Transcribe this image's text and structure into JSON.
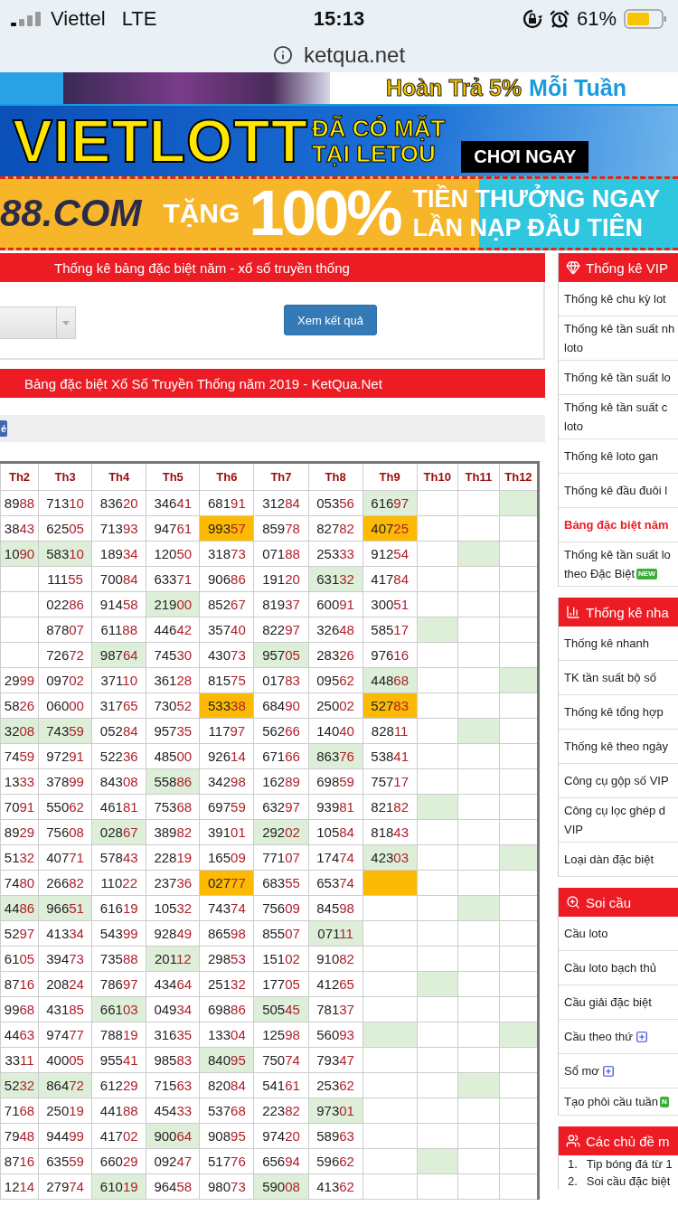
{
  "status_bar": {
    "carrier": "Viettel",
    "network": "LTE",
    "time": "15:13",
    "battery": "61%"
  },
  "address_bar": {
    "url": "ketqua.net"
  },
  "banners": [
    {
      "kind": "cashback",
      "texts": [
        "Hoàn Trả 5%",
        "Mỗi Tuần"
      ]
    },
    {
      "kind": "vietlott",
      "texts": [
        "VIETLOTT",
        "ĐÃ CÓ MẶT",
        "TẠI LETOU",
        "CHƠI NGAY"
      ]
    },
    {
      "kind": "bonus",
      "texts": [
        "88.COM",
        "TẶNG",
        "100%",
        "TIỀN THƯỞNG NGAY",
        "LẦN NẠP ĐẦU TIÊN"
      ]
    }
  ],
  "filter_panel": {
    "title": "Thống kê bảng đặc biệt năm - xổ số truyền thống",
    "button": "Xem kết quả"
  },
  "table_panel": {
    "title": "Bảng đặc biệt Xổ Số Truyền Thống năm 2019 - KetQua.Net",
    "share_button": "é"
  },
  "table": {
    "columns": [
      "Th2",
      "Th3",
      "Th4",
      "Th5",
      "Th6",
      "Th7",
      "Th8",
      "Th9",
      "Th10",
      "Th11",
      "Th12"
    ],
    "rows": [
      {
        "cells": [
          {
            "text": "8988",
            "color": "#ffffff"
          },
          {
            "text": "71310",
            "color": "#ffffff"
          },
          {
            "text": "83620",
            "color": "#ffffff"
          },
          {
            "text": "34641",
            "color": "#ffffff"
          },
          {
            "text": "68191",
            "color": "#ffffff"
          },
          {
            "text": "31284",
            "color": "#ffffff"
          },
          {
            "text": "05356",
            "color": "#ffffff"
          },
          {
            "text": "61697",
            "color": "#ddefd8"
          },
          {
            "color": "#ffffff"
          },
          {
            "color": "#ffffff"
          },
          {
            "color": "#ddefd8"
          }
        ]
      },
      {
        "cells": [
          {
            "text": "3843",
            "color": "#ffffff"
          },
          {
            "text": "62505",
            "color": "#ffffff"
          },
          {
            "text": "71393",
            "color": "#ffffff"
          },
          {
            "text": "94761",
            "color": "#ffffff"
          },
          {
            "text": "99357",
            "color": "#fdba05"
          },
          {
            "text": "85978",
            "color": "#ffffff"
          },
          {
            "text": "82782",
            "color": "#ffffff"
          },
          {
            "text": "40725",
            "color": "#fdba05"
          },
          {
            "color": "#ffffff"
          },
          {
            "color": "#ffffff"
          },
          {
            "color": "#ffffff"
          }
        ]
      },
      {
        "cells": [
          {
            "text": "1090",
            "color": "#ddefd8"
          },
          {
            "text": "58310",
            "color": "#ddefd8"
          },
          {
            "text": "18934",
            "color": "#ffffff"
          },
          {
            "text": "12050",
            "color": "#ffffff"
          },
          {
            "text": "31873",
            "color": "#ffffff"
          },
          {
            "text": "07188",
            "color": "#ffffff"
          },
          {
            "text": "25333",
            "color": "#ffffff"
          },
          {
            "text": "91254",
            "color": "#ffffff"
          },
          {
            "color": "#ffffff"
          },
          {
            "color": "#ddefd8"
          },
          {
            "color": "#ffffff"
          }
        ]
      },
      {
        "cells": [
          {
            "color": "#ffffff"
          },
          {
            "text": "11155",
            "color": "#ffffff"
          },
          {
            "text": "70084",
            "color": "#ffffff"
          },
          {
            "text": "63371",
            "color": "#ffffff"
          },
          {
            "text": "90686",
            "color": "#ffffff"
          },
          {
            "text": "19120",
            "color": "#ffffff"
          },
          {
            "text": "63132",
            "color": "#ddefd8"
          },
          {
            "text": "41784",
            "color": "#ffffff"
          },
          {
            "color": "#ffffff"
          },
          {
            "color": "#ffffff"
          },
          {
            "color": "#ffffff"
          }
        ]
      },
      {
        "cells": [
          {
            "color": "#ffffff"
          },
          {
            "text": "02286",
            "color": "#ffffff"
          },
          {
            "text": "91458",
            "color": "#ffffff"
          },
          {
            "text": "21900",
            "color": "#ddefd8"
          },
          {
            "text": "85267",
            "color": "#ffffff"
          },
          {
            "text": "81937",
            "color": "#ffffff"
          },
          {
            "text": "60091",
            "color": "#ffffff"
          },
          {
            "text": "30051",
            "color": "#ffffff"
          },
          {
            "color": "#ffffff"
          },
          {
            "color": "#ffffff"
          },
          {
            "color": "#ffffff"
          }
        ]
      },
      {
        "cells": [
          {
            "color": "#ffffff"
          },
          {
            "text": "87807",
            "color": "#ffffff"
          },
          {
            "text": "61188",
            "color": "#ffffff"
          },
          {
            "text": "44642",
            "color": "#ffffff"
          },
          {
            "text": "35740",
            "color": "#ffffff"
          },
          {
            "text": "82297",
            "color": "#ffffff"
          },
          {
            "text": "32648",
            "color": "#ffffff"
          },
          {
            "text": "58517",
            "color": "#ffffff"
          },
          {
            "color": "#ddefd8"
          },
          {
            "color": "#ffffff"
          },
          {
            "color": "#ffffff"
          }
        ]
      },
      {
        "cells": [
          {
            "color": "#ffffff"
          },
          {
            "text": "72672",
            "color": "#ffffff"
          },
          {
            "text": "98764",
            "color": "#ddefd8"
          },
          {
            "text": "74530",
            "color": "#ffffff"
          },
          {
            "text": "43073",
            "color": "#ffffff"
          },
          {
            "text": "95705",
            "color": "#ddefd8"
          },
          {
            "text": "28326",
            "color": "#ffffff"
          },
          {
            "text": "97616",
            "color": "#ffffff"
          },
          {
            "color": "#ffffff"
          },
          {
            "color": "#ffffff"
          },
          {
            "color": "#ffffff"
          }
        ]
      },
      {
        "cells": [
          {
            "text": "2999",
            "color": "#ffffff"
          },
          {
            "text": "09702",
            "color": "#ffffff"
          },
          {
            "text": "37110",
            "color": "#ffffff"
          },
          {
            "text": "36128",
            "color": "#ffffff"
          },
          {
            "text": "81575",
            "color": "#ffffff"
          },
          {
            "text": "01783",
            "color": "#ffffff"
          },
          {
            "text": "09562",
            "color": "#ffffff"
          },
          {
            "text": "44868",
            "color": "#ddefd8"
          },
          {
            "color": "#ffffff"
          },
          {
            "color": "#ffffff"
          },
          {
            "color": "#ddefd8"
          }
        ]
      },
      {
        "cells": [
          {
            "text": "5826",
            "color": "#ffffff"
          },
          {
            "text": "06000",
            "color": "#ffffff"
          },
          {
            "text": "31765",
            "color": "#ffffff"
          },
          {
            "text": "73052",
            "color": "#ffffff"
          },
          {
            "text": "53338",
            "color": "#fdba05"
          },
          {
            "text": "68490",
            "color": "#ffffff"
          },
          {
            "text": "25002",
            "color": "#ffffff"
          },
          {
            "text": "52783",
            "color": "#fdba05"
          },
          {
            "color": "#ffffff"
          },
          {
            "color": "#ffffff"
          },
          {
            "color": "#ffffff"
          }
        ]
      },
      {
        "cells": [
          {
            "text": "3208",
            "color": "#ddefd8"
          },
          {
            "text": "74359",
            "color": "#ddefd8"
          },
          {
            "text": "05284",
            "color": "#ffffff"
          },
          {
            "text": "95735",
            "color": "#ffffff"
          },
          {
            "text": "11797",
            "color": "#ffffff"
          },
          {
            "text": "56266",
            "color": "#ffffff"
          },
          {
            "text": "14040",
            "color": "#ffffff"
          },
          {
            "text": "82811",
            "color": "#ffffff"
          },
          {
            "color": "#ffffff"
          },
          {
            "color": "#ddefd8"
          },
          {
            "color": "#ffffff"
          }
        ]
      },
      {
        "cells": [
          {
            "text": "7459",
            "color": "#ffffff"
          },
          {
            "text": "97291",
            "color": "#ffffff"
          },
          {
            "text": "52236",
            "color": "#ffffff"
          },
          {
            "text": "48500",
            "color": "#ffffff"
          },
          {
            "text": "92614",
            "color": "#ffffff"
          },
          {
            "text": "67166",
            "color": "#ffffff"
          },
          {
            "text": "86376",
            "color": "#ddefd8"
          },
          {
            "text": "53841",
            "color": "#ffffff"
          },
          {
            "color": "#ffffff"
          },
          {
            "color": "#ffffff"
          },
          {
            "color": "#ffffff"
          }
        ]
      },
      {
        "cells": [
          {
            "text": "1333",
            "color": "#ffffff"
          },
          {
            "text": "37899",
            "color": "#ffffff"
          },
          {
            "text": "84308",
            "color": "#ffffff"
          },
          {
            "text": "55886",
            "color": "#ddefd8"
          },
          {
            "text": "34298",
            "color": "#ffffff"
          },
          {
            "text": "16289",
            "color": "#ffffff"
          },
          {
            "text": "69859",
            "color": "#ffffff"
          },
          {
            "text": "75717",
            "color": "#ffffff"
          },
          {
            "color": "#ffffff"
          },
          {
            "color": "#ffffff"
          },
          {
            "color": "#ffffff"
          }
        ]
      },
      {
        "cells": [
          {
            "text": "7091",
            "color": "#ffffff"
          },
          {
            "text": "55062",
            "color": "#ffffff"
          },
          {
            "text": "46181",
            "color": "#ffffff"
          },
          {
            "text": "75368",
            "color": "#ffffff"
          },
          {
            "text": "69759",
            "color": "#ffffff"
          },
          {
            "text": "63297",
            "color": "#ffffff"
          },
          {
            "text": "93981",
            "color": "#ffffff"
          },
          {
            "text": "82182",
            "color": "#ffffff"
          },
          {
            "color": "#ddefd8"
          },
          {
            "color": "#ffffff"
          },
          {
            "color": "#ffffff"
          }
        ]
      },
      {
        "cells": [
          {
            "text": "8929",
            "color": "#ffffff"
          },
          {
            "text": "75608",
            "color": "#ffffff"
          },
          {
            "text": "02867",
            "color": "#ddefd8"
          },
          {
            "text": "38982",
            "color": "#ffffff"
          },
          {
            "text": "39101",
            "color": "#ffffff"
          },
          {
            "text": "29202",
            "color": "#ddefd8"
          },
          {
            "text": "10584",
            "color": "#ffffff"
          },
          {
            "text": "81843",
            "color": "#ffffff"
          },
          {
            "color": "#ffffff"
          },
          {
            "color": "#ffffff"
          },
          {
            "color": "#ffffff"
          }
        ]
      },
      {
        "cells": [
          {
            "text": "5132",
            "color": "#ffffff"
          },
          {
            "text": "40771",
            "color": "#ffffff"
          },
          {
            "text": "57843",
            "color": "#ffffff"
          },
          {
            "text": "22819",
            "color": "#ffffff"
          },
          {
            "text": "16509",
            "color": "#ffffff"
          },
          {
            "text": "77107",
            "color": "#ffffff"
          },
          {
            "text": "17474",
            "color": "#ffffff"
          },
          {
            "text": "42303",
            "color": "#ddefd8"
          },
          {
            "color": "#ffffff"
          },
          {
            "color": "#ffffff"
          },
          {
            "color": "#ddefd8"
          }
        ]
      },
      {
        "cells": [
          {
            "text": "7480",
            "color": "#ffffff"
          },
          {
            "text": "26682",
            "color": "#ffffff"
          },
          {
            "text": "11022",
            "color": "#ffffff"
          },
          {
            "text": "23736",
            "color": "#ffffff"
          },
          {
            "text": "02777",
            "color": "#fdba05"
          },
          {
            "text": "68355",
            "color": "#ffffff"
          },
          {
            "text": "65374",
            "color": "#ffffff"
          },
          {
            "color": "#fdba05"
          },
          {
            "color": "#ffffff"
          },
          {
            "color": "#ffffff"
          },
          {
            "color": "#ffffff"
          }
        ]
      },
      {
        "cells": [
          {
            "text": "4486",
            "color": "#ddefd8"
          },
          {
            "text": "96651",
            "color": "#ddefd8"
          },
          {
            "text": "61619",
            "color": "#ffffff"
          },
          {
            "text": "10532",
            "color": "#ffffff"
          },
          {
            "text": "74374",
            "color": "#ffffff"
          },
          {
            "text": "75609",
            "color": "#ffffff"
          },
          {
            "text": "84598",
            "color": "#ffffff"
          },
          {
            "color": "#ffffff"
          },
          {
            "color": "#ffffff"
          },
          {
            "color": "#ddefd8"
          },
          {
            "color": "#ffffff"
          }
        ]
      },
      {
        "cells": [
          {
            "text": "5297",
            "color": "#ffffff"
          },
          {
            "text": "41334",
            "color": "#ffffff"
          },
          {
            "text": "54399",
            "color": "#ffffff"
          },
          {
            "text": "92849",
            "color": "#ffffff"
          },
          {
            "text": "86598",
            "color": "#ffffff"
          },
          {
            "text": "85507",
            "color": "#ffffff"
          },
          {
            "text": "07111",
            "color": "#ddefd8"
          },
          {
            "color": "#ffffff"
          },
          {
            "color": "#ffffff"
          },
          {
            "color": "#ffffff"
          },
          {
            "color": "#ffffff"
          }
        ]
      },
      {
        "cells": [
          {
            "text": "6105",
            "color": "#ffffff"
          },
          {
            "text": "39473",
            "color": "#ffffff"
          },
          {
            "text": "73588",
            "color": "#ffffff"
          },
          {
            "text": "20112",
            "color": "#ddefd8"
          },
          {
            "text": "29853",
            "color": "#ffffff"
          },
          {
            "text": "15102",
            "color": "#ffffff"
          },
          {
            "text": "91082",
            "color": "#ffffff"
          },
          {
            "color": "#ffffff"
          },
          {
            "color": "#ffffff"
          },
          {
            "color": "#ffffff"
          },
          {
            "color": "#ffffff"
          }
        ]
      },
      {
        "cells": [
          {
            "text": "8716",
            "color": "#ffffff"
          },
          {
            "text": "20824",
            "color": "#ffffff"
          },
          {
            "text": "78697",
            "color": "#ffffff"
          },
          {
            "text": "43464",
            "color": "#ffffff"
          },
          {
            "text": "25132",
            "color": "#ffffff"
          },
          {
            "text": "17705",
            "color": "#ffffff"
          },
          {
            "text": "41265",
            "color": "#ffffff"
          },
          {
            "color": "#ffffff"
          },
          {
            "color": "#ddefd8"
          },
          {
            "color": "#ffffff"
          },
          {
            "color": "#ffffff"
          }
        ]
      },
      {
        "cells": [
          {
            "text": "9968",
            "color": "#ffffff"
          },
          {
            "text": "43185",
            "color": "#ffffff"
          },
          {
            "text": "66103",
            "color": "#ddefd8"
          },
          {
            "text": "04934",
            "color": "#ffffff"
          },
          {
            "text": "69886",
            "color": "#ffffff"
          },
          {
            "text": "50545",
            "color": "#ddefd8"
          },
          {
            "text": "78137",
            "color": "#ffffff"
          },
          {
            "color": "#ffffff"
          },
          {
            "color": "#ffffff"
          },
          {
            "color": "#ffffff"
          },
          {
            "color": "#ffffff"
          }
        ]
      },
      {
        "cells": [
          {
            "text": "4463",
            "color": "#ffffff"
          },
          {
            "text": "97477",
            "color": "#ffffff"
          },
          {
            "text": "78819",
            "color": "#ffffff"
          },
          {
            "text": "31635",
            "color": "#ffffff"
          },
          {
            "text": "13304",
            "color": "#ffffff"
          },
          {
            "text": "12598",
            "color": "#ffffff"
          },
          {
            "text": "56093",
            "color": "#ffffff"
          },
          {
            "color": "#ddefd8"
          },
          {
            "color": "#ffffff"
          },
          {
            "color": "#ffffff"
          },
          {
            "color": "#ddefd8"
          }
        ]
      },
      {
        "cells": [
          {
            "text": "3311",
            "color": "#ffffff"
          },
          {
            "text": "40005",
            "color": "#ffffff"
          },
          {
            "text": "95541",
            "color": "#ffffff"
          },
          {
            "text": "98583",
            "color": "#ffffff"
          },
          {
            "text": "84095",
            "color": "#ddefd8"
          },
          {
            "text": "75074",
            "color": "#ffffff"
          },
          {
            "text": "79347",
            "color": "#ffffff"
          },
          {
            "color": "#ffffff"
          },
          {
            "color": "#ffffff"
          },
          {
            "color": "#ffffff"
          },
          {
            "color": "#ffffff"
          }
        ]
      },
      {
        "cells": [
          {
            "text": "5232",
            "color": "#ddefd8"
          },
          {
            "text": "86472",
            "color": "#ddefd8"
          },
          {
            "text": "61229",
            "color": "#ffffff"
          },
          {
            "text": "71563",
            "color": "#ffffff"
          },
          {
            "text": "82084",
            "color": "#ffffff"
          },
          {
            "text": "54161",
            "color": "#ffffff"
          },
          {
            "text": "25362",
            "color": "#ffffff"
          },
          {
            "color": "#ffffff"
          },
          {
            "color": "#ffffff"
          },
          {
            "color": "#ddefd8"
          },
          {
            "color": "#ffffff"
          }
        ]
      },
      {
        "cells": [
          {
            "text": "7168",
            "color": "#ffffff"
          },
          {
            "text": "25019",
            "color": "#ffffff"
          },
          {
            "text": "44188",
            "color": "#ffffff"
          },
          {
            "text": "45433",
            "color": "#ffffff"
          },
          {
            "text": "53768",
            "color": "#ffffff"
          },
          {
            "text": "22382",
            "color": "#ffffff"
          },
          {
            "text": "97301",
            "color": "#ddefd8"
          },
          {
            "color": "#ffffff"
          },
          {
            "color": "#ffffff"
          },
          {
            "color": "#ffffff"
          },
          {
            "color": "#ffffff"
          }
        ]
      },
      {
        "cells": [
          {
            "text": "7948",
            "color": "#ffffff"
          },
          {
            "text": "94499",
            "color": "#ffffff"
          },
          {
            "text": "41702",
            "color": "#ffffff"
          },
          {
            "text": "90064",
            "color": "#ddefd8"
          },
          {
            "text": "90895",
            "color": "#ffffff"
          },
          {
            "text": "97420",
            "color": "#ffffff"
          },
          {
            "text": "58963",
            "color": "#ffffff"
          },
          {
            "color": "#ffffff"
          },
          {
            "color": "#ffffff"
          },
          {
            "color": "#ffffff"
          },
          {
            "color": "#ffffff"
          }
        ]
      },
      {
        "cells": [
          {
            "text": "8716",
            "color": "#ffffff"
          },
          {
            "text": "63559",
            "color": "#ffffff"
          },
          {
            "text": "66029",
            "color": "#ffffff"
          },
          {
            "text": "09247",
            "color": "#ffffff"
          },
          {
            "text": "51776",
            "color": "#ffffff"
          },
          {
            "text": "65694",
            "color": "#ffffff"
          },
          {
            "text": "59662",
            "color": "#ffffff"
          },
          {
            "color": "#ffffff"
          },
          {
            "color": "#ddefd8"
          },
          {
            "color": "#ffffff"
          },
          {
            "color": "#ffffff"
          }
        ]
      },
      {
        "cells": [
          {
            "text": "1214",
            "color": "#ffffff"
          },
          {
            "text": "27974",
            "color": "#ffffff"
          },
          {
            "text": "61019",
            "color": "#ddefd8"
          },
          {
            "text": "96458",
            "color": "#ffffff"
          },
          {
            "text": "98073",
            "color": "#ffffff"
          },
          {
            "text": "59008",
            "color": "#ddefd8"
          },
          {
            "text": "41362",
            "color": "#ffffff"
          },
          {
            "color": "#ffffff"
          },
          {
            "color": "#ffffff"
          },
          {
            "color": "#ffffff"
          },
          {
            "color": "#ffffff"
          }
        ]
      }
    ]
  },
  "sidebar": {
    "sections": [
      {
        "kind": "vip",
        "title": "Thống kê VIP",
        "items": [
          {
            "kind": "plain",
            "lines": [
              "Thống kê chu kỳ lot"
            ],
            "selected": false
          },
          {
            "kind": "plain",
            "lines": [
              "Thống kê tần suất nh",
              "loto"
            ],
            "selected": false
          },
          {
            "kind": "plain",
            "lines": [
              "Thống kê tần suất lo"
            ],
            "selected": false
          },
          {
            "kind": "plain",
            "lines": [
              "Thống kê tần suất c",
              "loto"
            ],
            "selected": false
          },
          {
            "kind": "plain",
            "lines": [
              "Thống kê loto gan"
            ],
            "selected": false
          },
          {
            "kind": "plain",
            "lines": [
              "Thống kê đầu đuôi l"
            ],
            "selected": false
          },
          {
            "kind": "plain",
            "lines": [
              "Bảng đặc biệt năm"
            ],
            "selected": true
          },
          {
            "kind": "new",
            "lines": [
              "Thống kê tần suất lo",
              "theo Đặc Biệt"
            ],
            "badge": "NEW",
            "selected": false
          }
        ]
      },
      {
        "kind": "chart",
        "title": "Thống kê nha",
        "items": [
          {
            "kind": "plain",
            "lines": [
              "Thống kê nhanh"
            ],
            "selected": false
          },
          {
            "kind": "plain",
            "lines": [
              "TK tần suất bộ số"
            ],
            "selected": false
          },
          {
            "kind": "plain",
            "lines": [
              "Thống kê tổng hợp"
            ],
            "selected": false
          },
          {
            "kind": "plain",
            "lines": [
              "Thống kê theo ngày"
            ],
            "selected": false
          },
          {
            "kind": "plain",
            "lines": [
              "Công cụ gộp số VIP"
            ],
            "selected": false
          },
          {
            "kind": "plain",
            "lines": [
              "Công cụ lọc ghép d",
              "VIP"
            ],
            "selected": false
          },
          {
            "kind": "plain",
            "lines": [
              "Loại dàn đặc biệt"
            ],
            "selected": false
          }
        ]
      },
      {
        "kind": "search",
        "title": "Soi cầu",
        "items": [
          {
            "kind": "plain",
            "lines": [
              "Cầu loto"
            ],
            "selected": false
          },
          {
            "kind": "plain",
            "lines": [
              "Cầu loto bạch thủ"
            ],
            "selected": false
          },
          {
            "kind": "plain",
            "lines": [
              "Cầu giải đặc biệt"
            ],
            "selected": false
          },
          {
            "kind": "expand",
            "lines": [
              "Cầu theo thứ"
            ],
            "selected": false
          },
          {
            "kind": "expand",
            "lines": [
              "Sổ mơ"
            ],
            "selected": false
          },
          {
            "kind": "new",
            "lines": [
              "Tạo phôi cầu tuần"
            ],
            "badge": "N",
            "selected": false
          }
        ]
      },
      {
        "kind": "topics",
        "title": "Các chủ đề m",
        "items": [
          {
            "kind": "numbered",
            "number": "1.",
            "lines": [
              "Tip bóng đá từ 1"
            ]
          },
          {
            "kind": "numbered",
            "number": "2.",
            "lines": [
              "Soi cầu đặc biệt"
            ]
          }
        ]
      }
    ]
  }
}
